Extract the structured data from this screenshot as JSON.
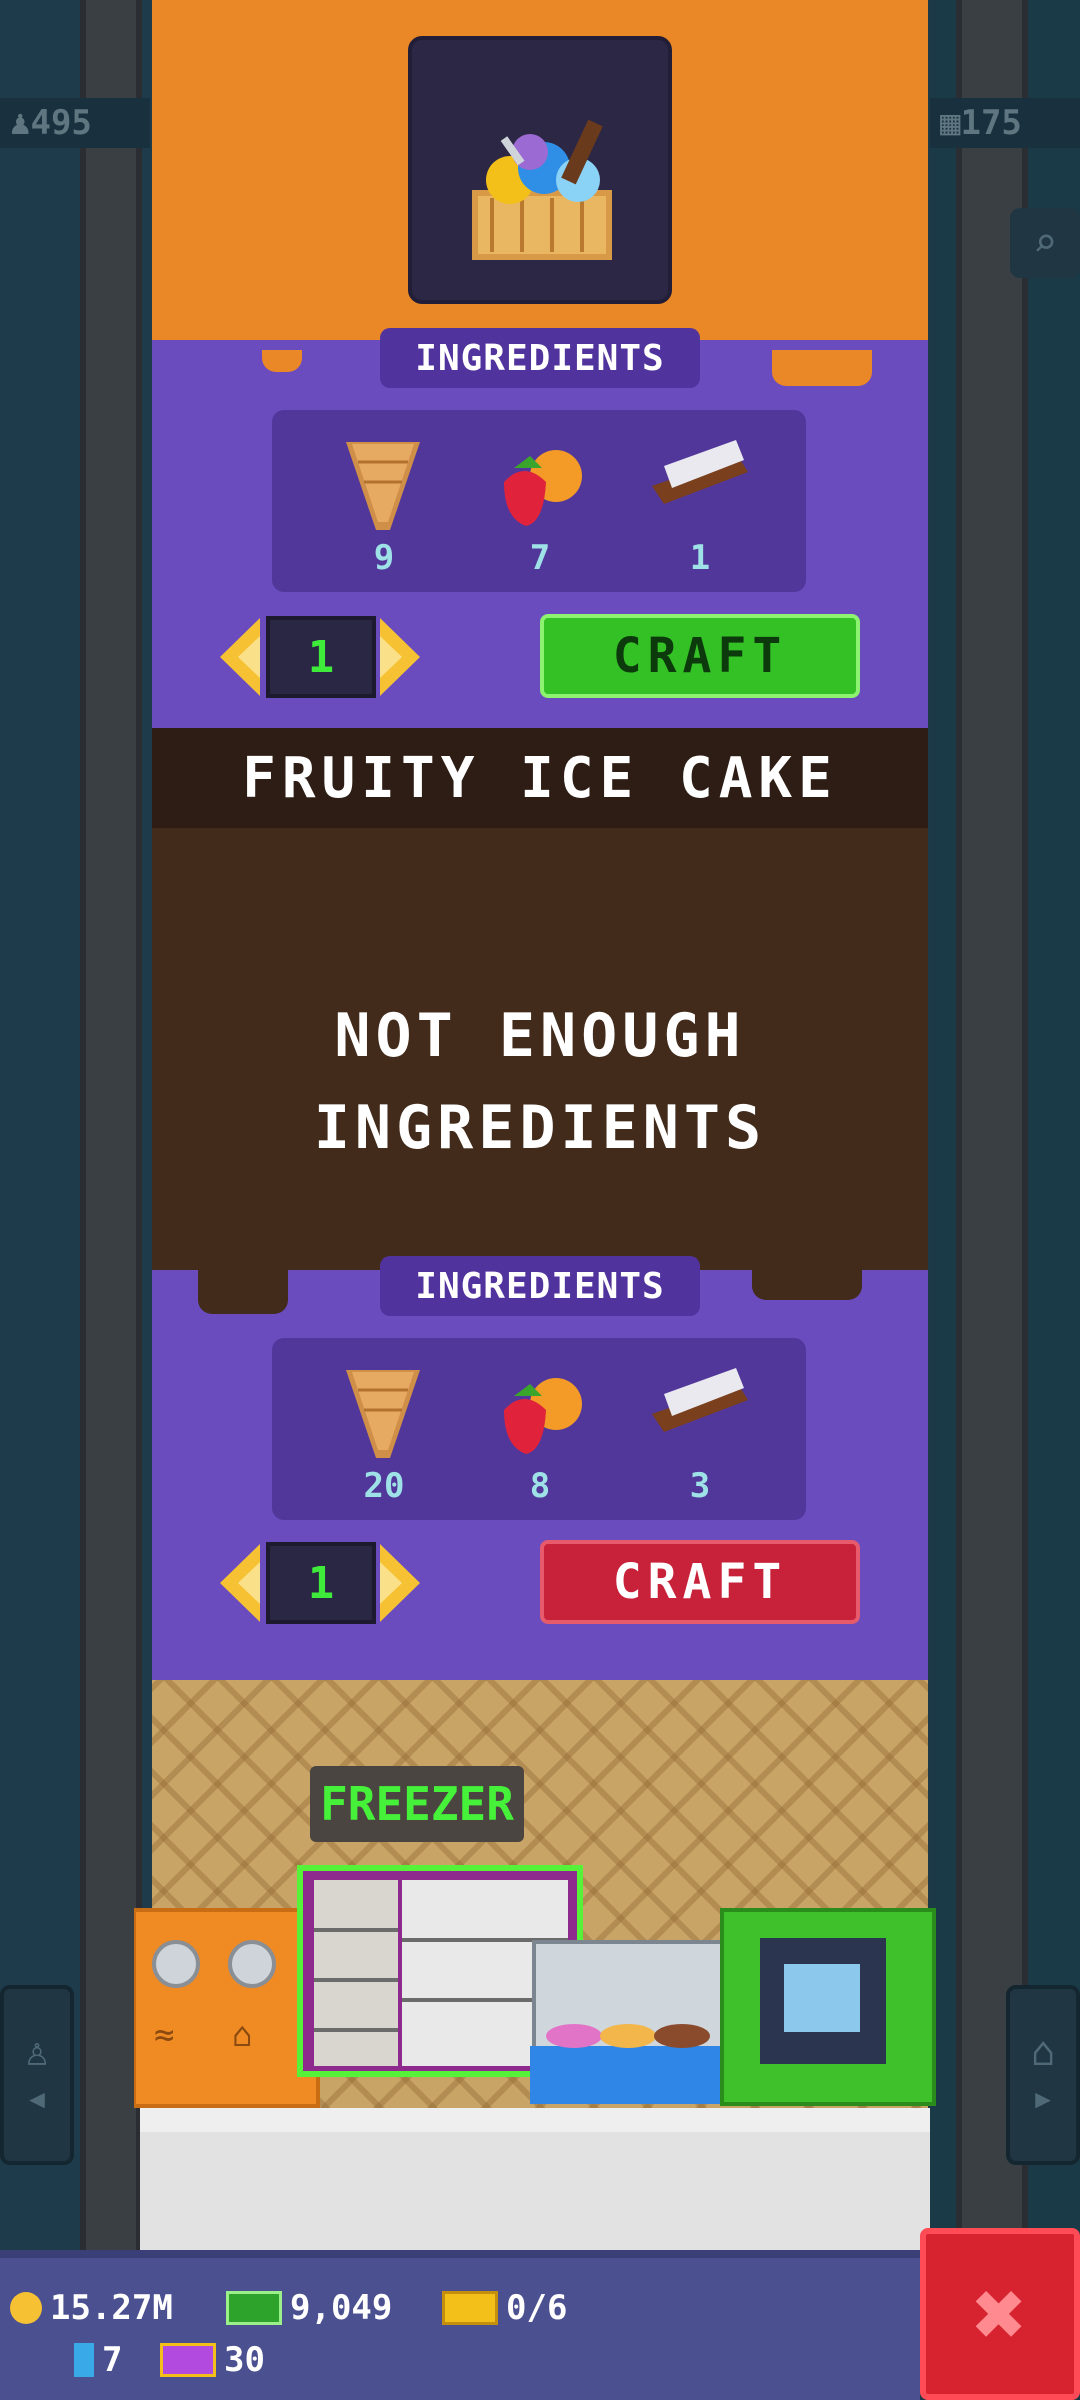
{
  "side": {
    "left_counter": "495",
    "right_counter": "175"
  },
  "recipe_top": {
    "section_label": "INGREDIENTS",
    "ingredients": [
      {
        "icon": "cone-icon",
        "count": "9"
      },
      {
        "icon": "fruit-icon",
        "count": "7"
      },
      {
        "icon": "chocolate-bar-icon",
        "count": "1"
      }
    ],
    "quantity": "1",
    "craft_label": "CRAFT",
    "craft_color": "#34c126"
  },
  "recipe_bottom": {
    "title": "FRUITY ICE CAKE",
    "status_line1": "NOT ENOUGH",
    "status_line2": "INGREDIENTS",
    "section_label": "INGREDIENTS",
    "ingredients": [
      {
        "icon": "cone-icon",
        "count": "20"
      },
      {
        "icon": "fruit-icon",
        "count": "8"
      },
      {
        "icon": "chocolate-bar-icon",
        "count": "3"
      }
    ],
    "quantity": "1",
    "craft_label": "CRAFT",
    "craft_color": "#c8213a"
  },
  "shop": {
    "name": "FREEZER"
  },
  "stats": {
    "coins": "15.27M",
    "cash": "9,049",
    "tickets": "0/6",
    "bux": "7",
    "vip": "30"
  }
}
